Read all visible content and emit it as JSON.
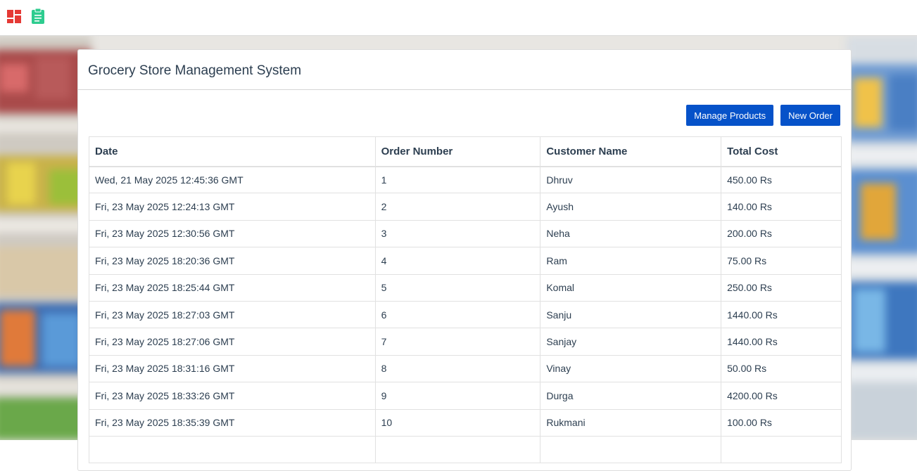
{
  "header": {
    "dashboard_icon": "dashboard-grid-icon",
    "clipboard_icon": "clipboard-icon"
  },
  "panel": {
    "title": "Grocery Store Management System"
  },
  "actions": {
    "manage_products_label": "Manage Products",
    "new_order_label": "New Order"
  },
  "table": {
    "headers": [
      "Date",
      "Order Number",
      "Customer Name",
      "Total Cost"
    ],
    "rows": [
      [
        "Wed, 21 May 2025 12:45:36 GMT",
        "1",
        "Dhruv",
        "450.00 Rs"
      ],
      [
        "Fri, 23 May 2025 12:24:13 GMT",
        "2",
        "Ayush",
        "140.00 Rs"
      ],
      [
        "Fri, 23 May 2025 12:30:56 GMT",
        "3",
        "Neha",
        "200.00 Rs"
      ],
      [
        "Fri, 23 May 2025 18:20:36 GMT",
        "4",
        "Ram",
        "75.00 Rs"
      ],
      [
        "Fri, 23 May 2025 18:25:44 GMT",
        "5",
        "Komal",
        "250.00 Rs"
      ],
      [
        "Fri, 23 May 2025 18:27:03 GMT",
        "6",
        "Sanju",
        "1440.00 Rs"
      ],
      [
        "Fri, 23 May 2025 18:27:06 GMT",
        "7",
        "Sanjay",
        "1440.00 Rs"
      ],
      [
        "Fri, 23 May 2025 18:31:16 GMT",
        "8",
        "Vinay",
        "50.00 Rs"
      ],
      [
        "Fri, 23 May 2025 18:33:26 GMT",
        "9",
        "Durga",
        "4200.00 Rs"
      ],
      [
        "Fri, 23 May 2025 18:35:39 GMT",
        "10",
        "Rukmani",
        "100.00 Rs"
      ]
    ]
  },
  "colors": {
    "accent": "#0652c9",
    "dashboard_icon": "#e53935",
    "clipboard_icon": "#2ecc8f"
  }
}
